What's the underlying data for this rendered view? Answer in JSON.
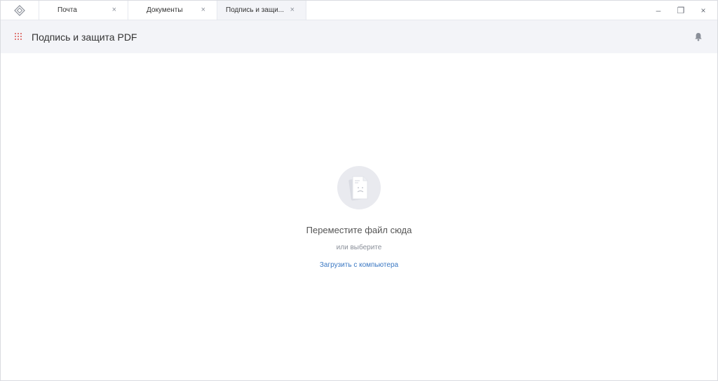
{
  "tabs": [
    {
      "label": "Почта",
      "close": "×"
    },
    {
      "label": "Документы",
      "close": "×"
    },
    {
      "label": "Подпись и защи...",
      "close": "×"
    }
  ],
  "window_controls": {
    "minimize": "–",
    "restore": "❐",
    "close": "×"
  },
  "header": {
    "title": "Подпись и защита PDF"
  },
  "dropzone": {
    "title": "Переместите файл сюда",
    "or_text": "или выберите",
    "upload_link": "Загрузить с компьютера"
  },
  "colors": {
    "accent_link": "#3b78c3",
    "grid_icon": "#d9534f",
    "header_bg": "#f3f4f8"
  }
}
